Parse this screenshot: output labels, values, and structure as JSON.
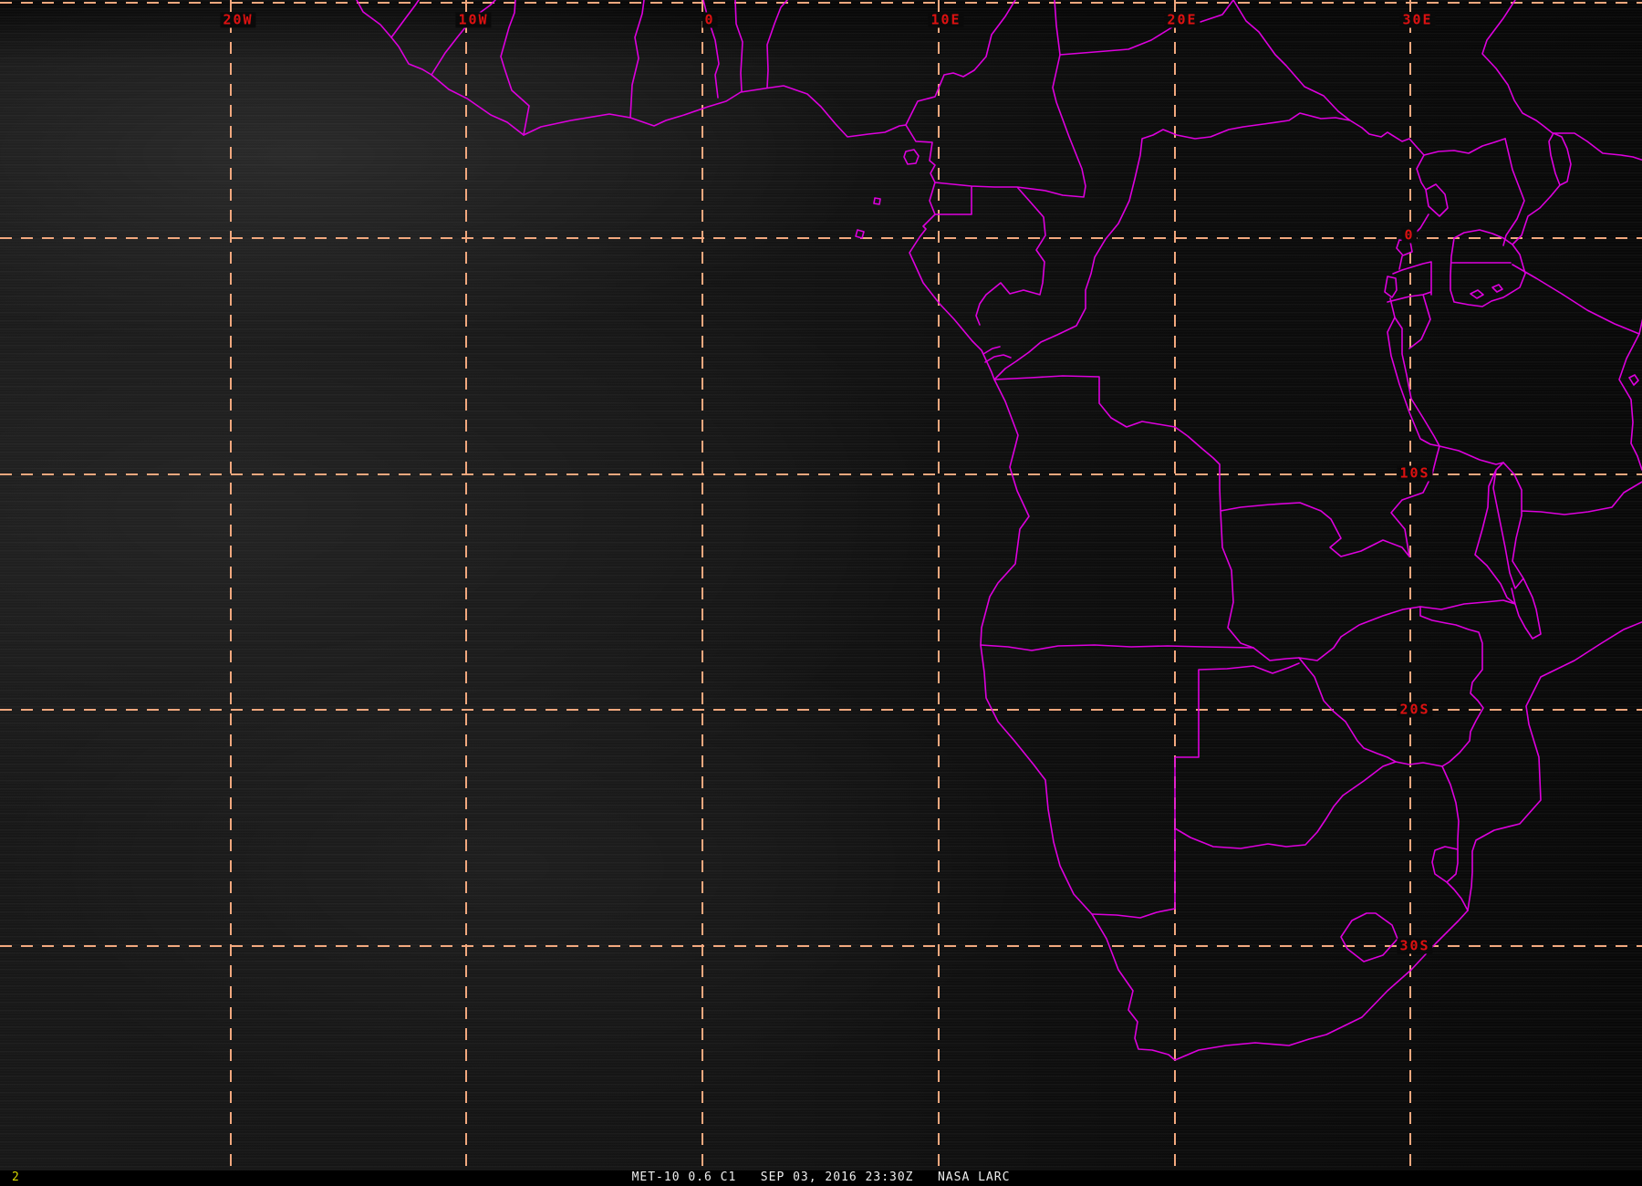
{
  "viewer": {
    "product": {
      "satellite": "MET-10",
      "channel": "0.6 C1",
      "datetime": "SEP 03, 2016 23:30Z",
      "source": "NASA LARC",
      "caption": "MET-10 0.6 C1   SEP 03, 2016 23:30Z   NASA LARC"
    },
    "frame_indicator": "2"
  },
  "grid": {
    "lon_labels": [
      "20W",
      "10W",
      "0",
      "10E",
      "20E",
      "30E"
    ],
    "lat_labels": [
      "0",
      "10S",
      "20S",
      "30S"
    ]
  },
  "colors": {
    "graticule": "#f2a87e",
    "graticule_text": "#dd1111",
    "borders": "#dd00dd",
    "caption_text": "#efefef",
    "frame_text": "#d6d600",
    "caption_bar": "#000000",
    "background": "#101010"
  }
}
